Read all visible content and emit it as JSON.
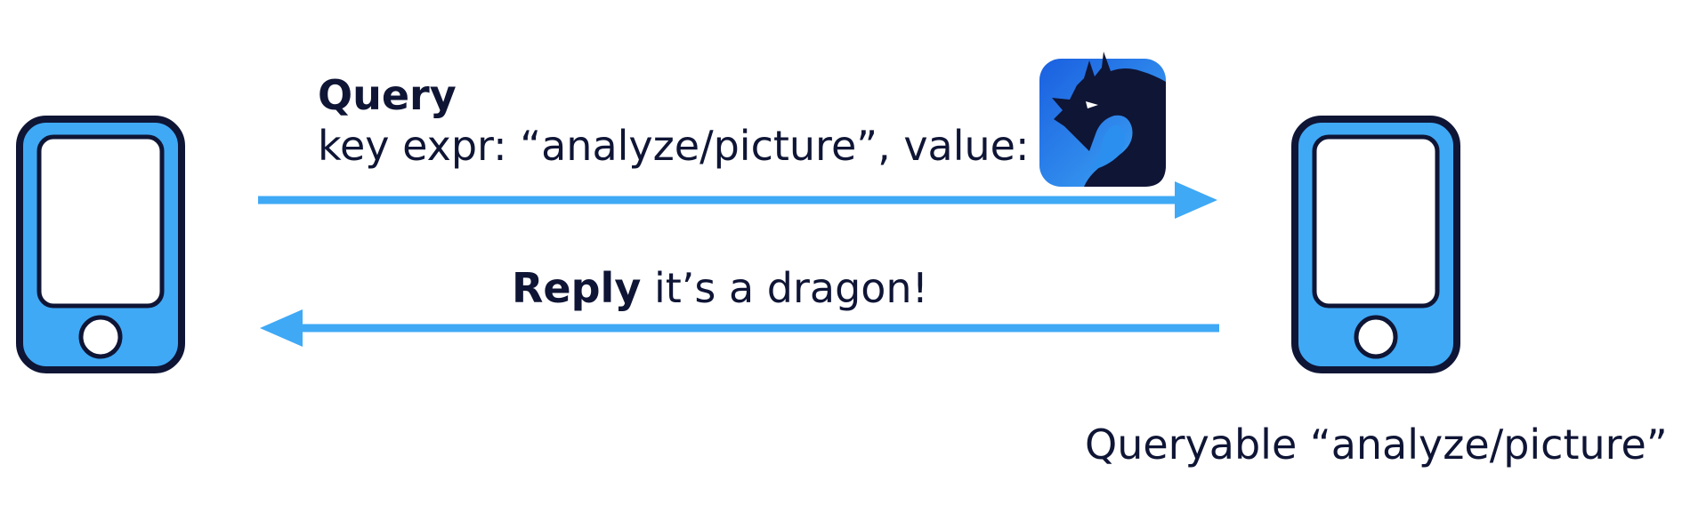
{
  "query": {
    "title": "Query",
    "detail": "key expr: “analyze/picture”, value:"
  },
  "reply": {
    "title": "Reply",
    "text": "it’s a dragon!"
  },
  "queryable": {
    "caption": "Queryable “analyze/picture”"
  },
  "icons": {
    "left_device": "phone-icon",
    "right_device": "phone-icon",
    "value_image": "dragon-logo-icon"
  },
  "colors": {
    "accent_blue": "#3fa9f5",
    "dark_navy": "#0f1535",
    "logo_blue": "#1e6ee8"
  }
}
